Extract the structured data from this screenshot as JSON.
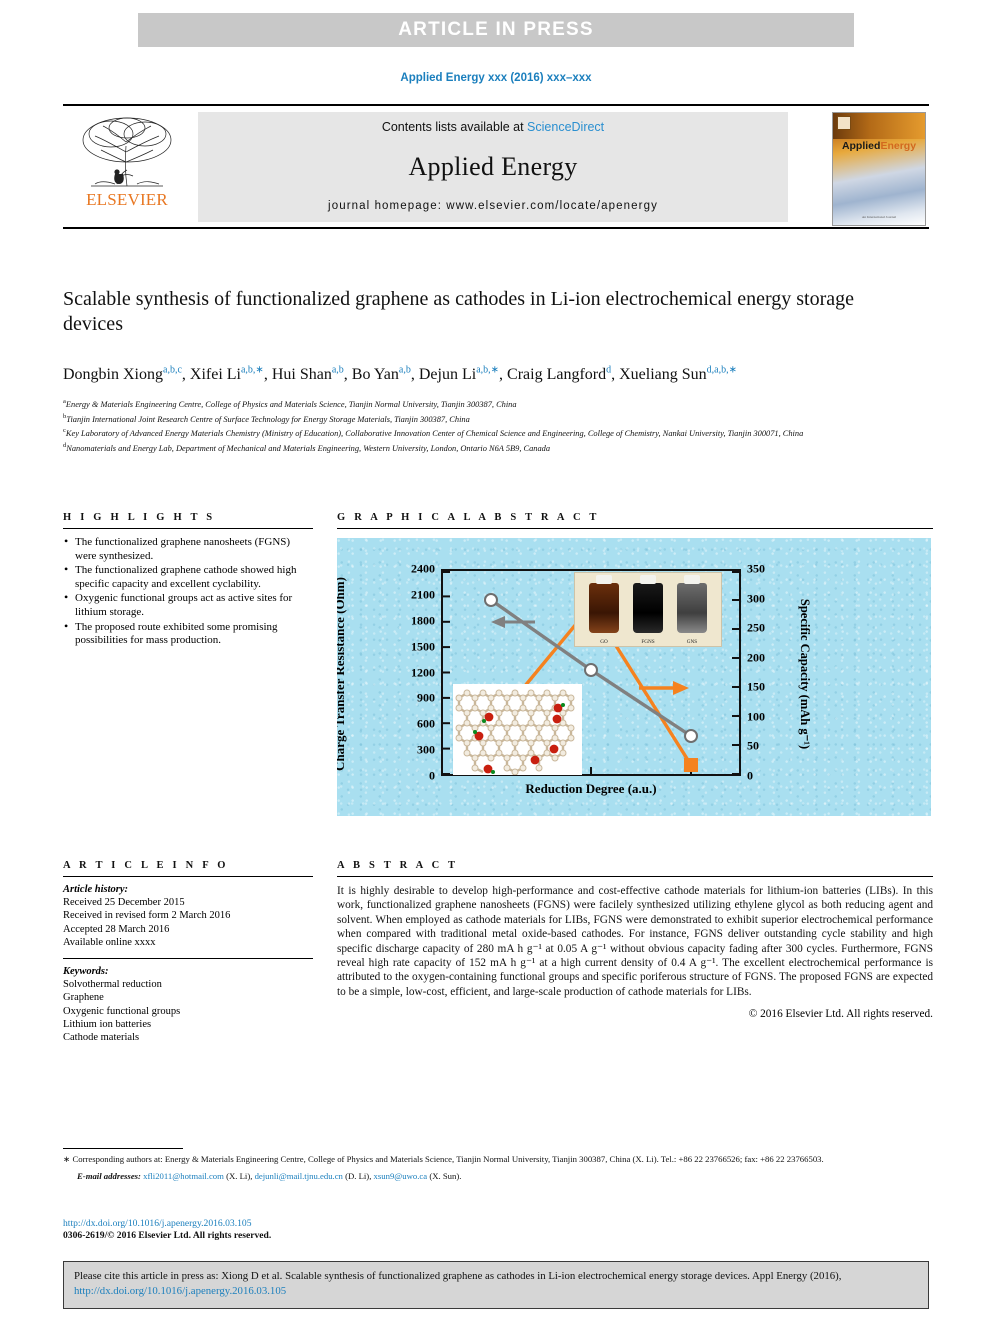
{
  "banner": {
    "text": "ARTICLE  IN  PRESS"
  },
  "journal_ref": "Applied Energy xxx (2016) xxx–xxx",
  "masthead": {
    "publisher": "ELSEVIER",
    "contents_prefix": "Contents lists available at ",
    "contents_link": "ScienceDirect",
    "journal_name": "Applied Energy",
    "homepage": "journal homepage: www.elsevier.com/locate/apenergy",
    "cover_title_a": "Applied",
    "cover_title_b": "Energy",
    "cover_footnote": "An International Journal"
  },
  "article": {
    "title": "Scalable synthesis of functionalized graphene as cathodes in Li-ion electrochemical energy storage devices",
    "authors": [
      {
        "name": "Dongbin Xiong",
        "sup": "a,b,c"
      },
      {
        "name": "Xifei Li",
        "sup": "a,b,∗"
      },
      {
        "name": "Hui Shan",
        "sup": "a,b"
      },
      {
        "name": "Bo Yan",
        "sup": "a,b"
      },
      {
        "name": "Dejun Li",
        "sup": "a,b,∗"
      },
      {
        "name": "Craig Langford",
        "sup": "d"
      },
      {
        "name": "Xueliang Sun",
        "sup": "d,a,b,∗"
      }
    ],
    "affiliations": [
      {
        "mark": "a",
        "text": "Energy & Materials Engineering Centre, College of Physics and Materials Science, Tianjin Normal University, Tianjin 300387, China"
      },
      {
        "mark": "b",
        "text": "Tianjin International Joint Research Centre of Surface Technology for Energy Storage Materials, Tianjin 300387, China"
      },
      {
        "mark": "c",
        "text": "Key Laboratory of Advanced Energy Materials Chemistry (Ministry of Education), Collaborative Innovation Center of Chemical Science and Engineering, College of Chemistry, Nankai University, Tianjin 300071, China"
      },
      {
        "mark": "d",
        "text": "Nanomaterials and Energy Lab, Department of Mechanical and Materials Engineering, Western University, London, Ontario N6A 5B9, Canada"
      }
    ]
  },
  "highlights": {
    "heading": "H I G H L I G H T S",
    "items": [
      "The functionalized graphene nanosheets (FGNS) were synthesized.",
      "The functionalized graphene cathode showed high specific capacity and excellent cyclability.",
      "Oxygenic functional groups act as active sites for lithium storage.",
      "The proposed route exhibited some promising possibilities for mass production."
    ]
  },
  "graphical_abstract": {
    "heading": "G R A P H I C A L   A B S T R A C T"
  },
  "chart_data": {
    "type": "line",
    "title": "",
    "xlabel": "Reduction Degree (a.u.)",
    "ylabel": "Charge Transfer Resistance (Ohm)",
    "y2label": "Specific Capacity (mAh g⁻¹)",
    "x": [
      "GO",
      "FGNS",
      "GNS"
    ],
    "xlim": [
      0,
      1
    ],
    "ylim": [
      0,
      2400
    ],
    "y2lim": [
      0,
      350
    ],
    "yticks": [
      0,
      300,
      600,
      900,
      1200,
      1500,
      1800,
      2100,
      2400
    ],
    "y2ticks": [
      0,
      50,
      100,
      150,
      200,
      250,
      300,
      350
    ],
    "grid": false,
    "legend": "none",
    "series": [
      {
        "name": "Charge Transfer Resistance (Ohm)",
        "axis": "left",
        "color": "#808080",
        "marker": "open-circle",
        "values": [
          2050,
          1230,
          450
        ]
      },
      {
        "name": "Specific Capacity (mAh g⁻¹)",
        "axis": "right",
        "color": "#F5821F",
        "marker": "filled-square",
        "values": [
          80,
          290,
          15
        ]
      }
    ],
    "annotations": [
      {
        "type": "arrow",
        "direction": "left",
        "color": "#808080",
        "note": "points to left axis"
      },
      {
        "type": "arrow",
        "direction": "right",
        "color": "#F5821F",
        "note": "points to right axis"
      }
    ],
    "insets": [
      {
        "name": "bottle-photo-inset",
        "labels": [
          "GO",
          "FGNS",
          "GNS"
        ]
      },
      {
        "name": "graphene-lattice-inset",
        "labels": []
      }
    ],
    "background_color": "#a9dff0"
  },
  "article_info": {
    "heading": "A R T I C L E   I N F O",
    "history_label": "Article history:",
    "history": [
      "Received 25 December 2015",
      "Received in revised form 2 March 2016",
      "Accepted 28 March 2016",
      "Available online xxxx"
    ],
    "keywords_label": "Keywords:",
    "keywords": [
      "Solvothermal reduction",
      "Graphene",
      "Oxygenic functional groups",
      "Lithium ion batteries",
      "Cathode materials"
    ]
  },
  "abstract": {
    "heading": "A B S T R A C T",
    "body": "It is highly desirable to develop high-performance and cost-effective cathode materials for lithium-ion batteries (LIBs). In this work, functionalized graphene nanosheets (FGNS) were facilely synthesized utilizing ethylene glycol as both reducing agent and solvent. When employed as cathode materials for LIBs, FGNS were demonstrated to exhibit superior electrochemical performance when compared with traditional metal oxide-based cathodes. For instance, FGNS deliver outstanding cycle stability and high specific discharge capacity of 280 mA h g⁻¹ at 0.05 A g⁻¹ without obvious capacity fading after 300 cycles. Furthermore, FGNS reveal high rate capacity of 152 mA h g⁻¹ at a high current density of 0.4 A g⁻¹. The excellent electrochemical performance is attributed to the oxygen-containing functional groups and specific poriferous structure of FGNS. The proposed FGNS are expected to be a simple, low-cost, efficient, and large-scale production of cathode materials for LIBs.",
    "copyright": "© 2016 Elsevier Ltd. All rights reserved."
  },
  "footnotes": {
    "corresponding": "∗ Corresponding authors at: Energy & Materials Engineering Centre, College of Physics and Materials Science, Tianjin Normal University, Tianjin 300387, China (X. Li). Tel.: +86 22 23766526; fax: +86 22 23766503.",
    "email_label": "E-mail addresses:",
    "emails": [
      {
        "address": "xfli2011@hotmail.com",
        "who": "(X. Li),"
      },
      {
        "address": "dejunli@mail.tjnu.edu.cn",
        "who": "(D. Li),"
      },
      {
        "address": "xsun9@uwo.ca",
        "who": "(X. Sun)."
      }
    ],
    "doi": "http://dx.doi.org/10.1016/j.apenergy.2016.03.105",
    "issn": "0306-2619/© 2016 Elsevier Ltd. All rights reserved."
  },
  "cite_box": {
    "text": "Please cite this article in press as: Xiong D et al. Scalable synthesis of functionalized graphene as cathodes in Li-ion electrochemical energy storage devices. Appl Energy (2016), ",
    "link": "http://dx.doi.org/10.1016/j.apenergy.2016.03.105"
  }
}
